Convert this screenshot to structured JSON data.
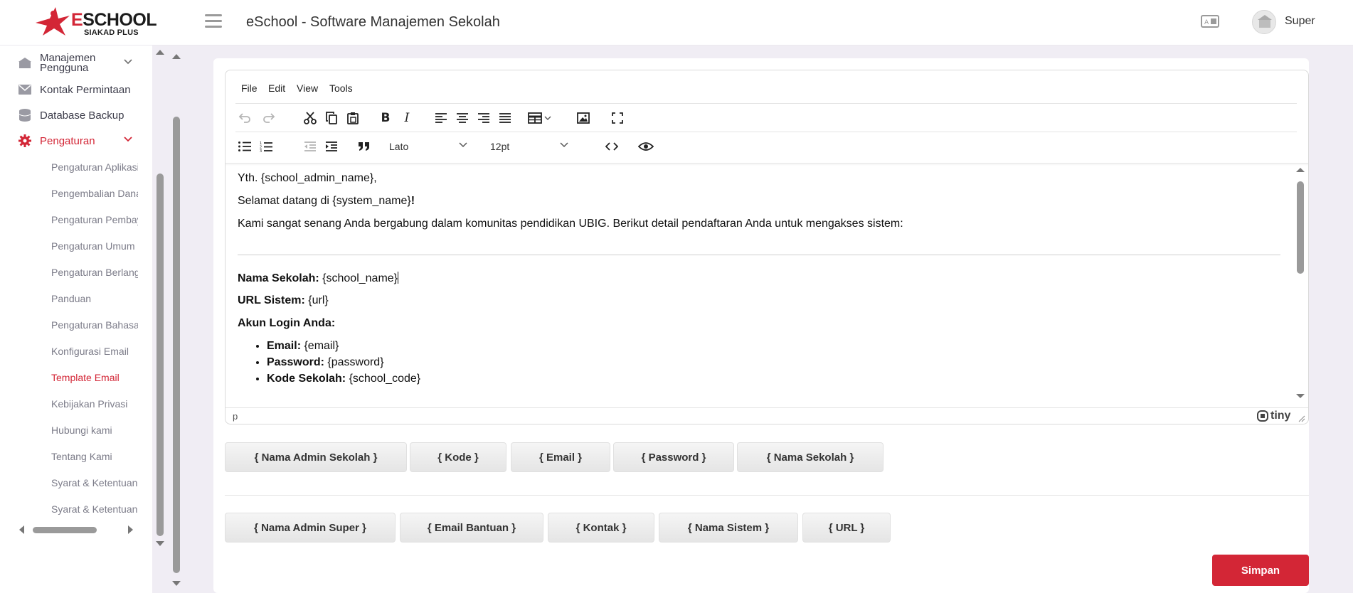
{
  "brand": {
    "name_e": "E",
    "name_rest": "SCHOOL",
    "tagline": "SIAKAD PLUS",
    "accent_color": "#d32636"
  },
  "header": {
    "title": "eSchool - Software Manajemen Sekolah",
    "user_name": "Super",
    "menu_icon": "hamburger-icon",
    "language_icon": "language-icon"
  },
  "sidebar": {
    "items": [
      {
        "label": "Manajemen Pengguna",
        "icon": "users-icon",
        "expandable": true
      },
      {
        "label": "Kontak Permintaan",
        "icon": "mail-icon"
      },
      {
        "label": "Database Backup",
        "icon": "database-icon"
      },
      {
        "label": "Pengaturan",
        "icon": "gear-icon",
        "expandable": true,
        "active": true
      }
    ],
    "subitems": [
      "Pengaturan Aplikasi",
      "Pengembalian Dana",
      "Pengaturan Pembayaran",
      "Pengaturan Umum",
      "Pengaturan Berlangganan",
      "Panduan",
      "Pengaturan Bahasa",
      "Konfigurasi Email",
      "Template Email",
      "Kebijakan Privasi",
      "Hubungi kami",
      "Tentang Kami",
      "Syarat & Ketentuan",
      "Syarat & Ketentuan"
    ],
    "active_subitem": "Template Email"
  },
  "editor": {
    "menus": [
      "File",
      "Edit",
      "View",
      "Tools"
    ],
    "font_family": "Lato",
    "font_size": "12pt",
    "status_path": "p",
    "brand": "tiny",
    "content": {
      "greeting": "Yth. {school_admin_name},",
      "welcome_prefix": "Selamat datang di {system_name}",
      "welcome_suffix": "!",
      "intro": "Kami sangat senang Anda bergabung dalam komunitas pendidikan UBIG. Berikut detail pendaftaran Anda untuk mengakses sistem:",
      "school_label": "Nama Sekolah:",
      "school_value": " {school_name}",
      "url_label": "URL Sistem:",
      "url_value": " {url}",
      "login_heading": "Akun Login Anda:",
      "login_items": [
        {
          "label": "Email:",
          "value": " {email}"
        },
        {
          "label": "Password:",
          "value": " {password}"
        },
        {
          "label": "Kode Sekolah:",
          "value": " {school_code}"
        }
      ]
    }
  },
  "placeholders_row1": [
    "{ Nama Admin Sekolah }",
    "{ Kode }",
    "{ Email }",
    "{ Password }",
    "{ Nama Sekolah }"
  ],
  "placeholders_row2": [
    "{ Nama Admin Super }",
    "{ Email Bantuan }",
    "{ Kontak }",
    "{ Nama Sistem }",
    "{ URL }"
  ],
  "actions": {
    "save_label": "Simpan"
  }
}
